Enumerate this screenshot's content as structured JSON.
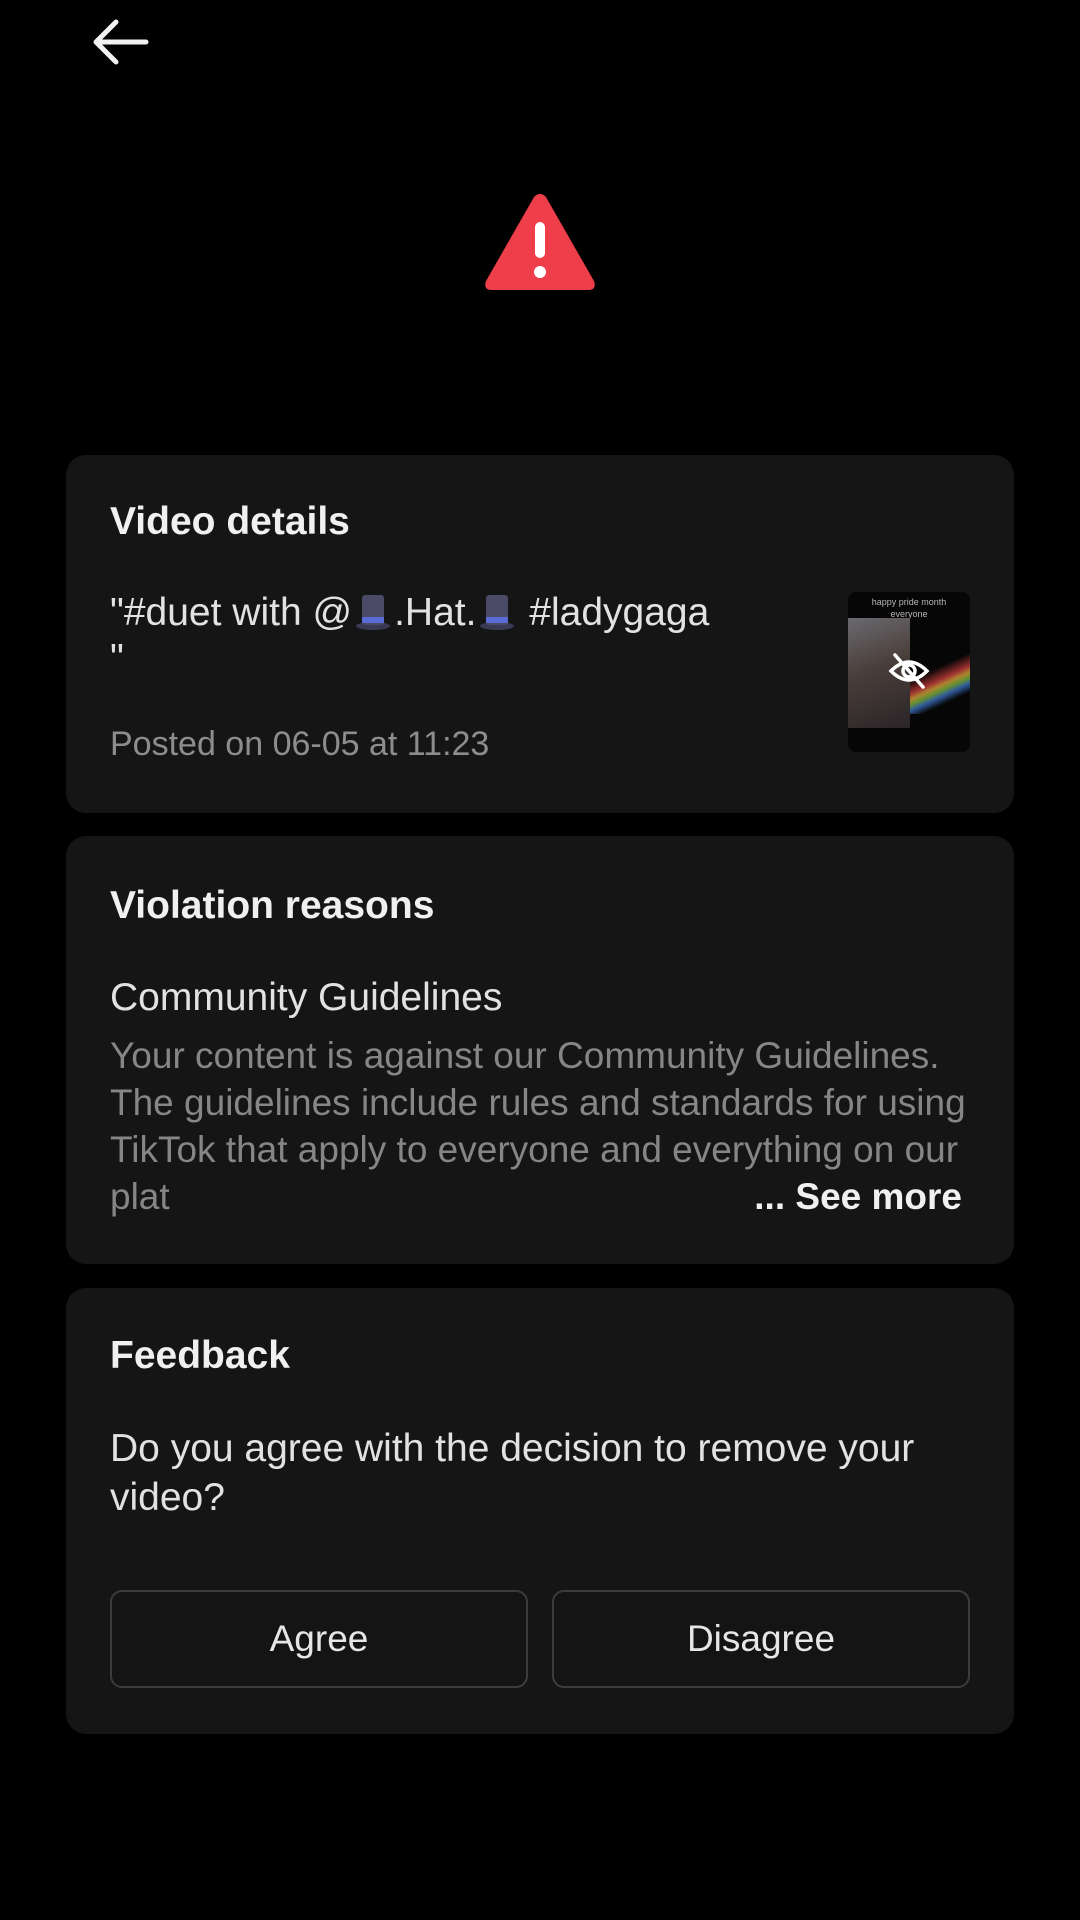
{
  "header": {
    "back_icon": "arrow-left-icon",
    "alert_icon": "warning-triangle-icon",
    "alert_color": "#ee3e49"
  },
  "video_details": {
    "title": "Video details",
    "caption_line1_part1": "\"#duet with @",
    "caption_line1_part2": ".Hat.",
    "caption_line1_part3": " #ladygaga",
    "caption_line2": "\"",
    "caption_emoji": "top-hat-emoji",
    "posted": "Posted on 06-05 at 11:23",
    "thumbnail_text_line1": "happy pride month",
    "thumbnail_text_line2": "everyone",
    "thumbnail_icon": "eye-slash-icon"
  },
  "violation": {
    "title": "Violation reasons",
    "guideline_name": "Community Guidelines",
    "description": "Your content is against our Community Guidelines. The guidelines include rules and standards for using TikTok that apply to everyone and everything on our plat",
    "see_more": "... See more"
  },
  "feedback": {
    "title": "Feedback",
    "question": "Do you agree with the decision to remove your video?",
    "agree_label": "Agree",
    "disagree_label": "Disagree"
  }
}
